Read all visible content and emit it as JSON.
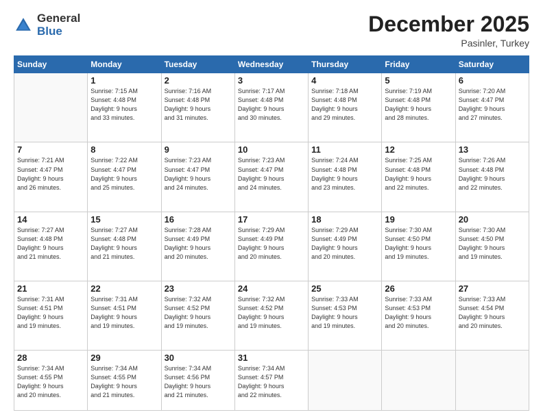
{
  "header": {
    "logo_general": "General",
    "logo_blue": "Blue",
    "month_title": "December 2025",
    "location": "Pasinler, Turkey"
  },
  "weekdays": [
    "Sunday",
    "Monday",
    "Tuesday",
    "Wednesday",
    "Thursday",
    "Friday",
    "Saturday"
  ],
  "weeks": [
    [
      {
        "day": "",
        "info": ""
      },
      {
        "day": "1",
        "info": "Sunrise: 7:15 AM\nSunset: 4:48 PM\nDaylight: 9 hours\nand 33 minutes."
      },
      {
        "day": "2",
        "info": "Sunrise: 7:16 AM\nSunset: 4:48 PM\nDaylight: 9 hours\nand 31 minutes."
      },
      {
        "day": "3",
        "info": "Sunrise: 7:17 AM\nSunset: 4:48 PM\nDaylight: 9 hours\nand 30 minutes."
      },
      {
        "day": "4",
        "info": "Sunrise: 7:18 AM\nSunset: 4:48 PM\nDaylight: 9 hours\nand 29 minutes."
      },
      {
        "day": "5",
        "info": "Sunrise: 7:19 AM\nSunset: 4:48 PM\nDaylight: 9 hours\nand 28 minutes."
      },
      {
        "day": "6",
        "info": "Sunrise: 7:20 AM\nSunset: 4:47 PM\nDaylight: 9 hours\nand 27 minutes."
      }
    ],
    [
      {
        "day": "7",
        "info": "Sunrise: 7:21 AM\nSunset: 4:47 PM\nDaylight: 9 hours\nand 26 minutes."
      },
      {
        "day": "8",
        "info": "Sunrise: 7:22 AM\nSunset: 4:47 PM\nDaylight: 9 hours\nand 25 minutes."
      },
      {
        "day": "9",
        "info": "Sunrise: 7:23 AM\nSunset: 4:47 PM\nDaylight: 9 hours\nand 24 minutes."
      },
      {
        "day": "10",
        "info": "Sunrise: 7:23 AM\nSunset: 4:47 PM\nDaylight: 9 hours\nand 24 minutes."
      },
      {
        "day": "11",
        "info": "Sunrise: 7:24 AM\nSunset: 4:48 PM\nDaylight: 9 hours\nand 23 minutes."
      },
      {
        "day": "12",
        "info": "Sunrise: 7:25 AM\nSunset: 4:48 PM\nDaylight: 9 hours\nand 22 minutes."
      },
      {
        "day": "13",
        "info": "Sunrise: 7:26 AM\nSunset: 4:48 PM\nDaylight: 9 hours\nand 22 minutes."
      }
    ],
    [
      {
        "day": "14",
        "info": "Sunrise: 7:27 AM\nSunset: 4:48 PM\nDaylight: 9 hours\nand 21 minutes."
      },
      {
        "day": "15",
        "info": "Sunrise: 7:27 AM\nSunset: 4:48 PM\nDaylight: 9 hours\nand 21 minutes."
      },
      {
        "day": "16",
        "info": "Sunrise: 7:28 AM\nSunset: 4:49 PM\nDaylight: 9 hours\nand 20 minutes."
      },
      {
        "day": "17",
        "info": "Sunrise: 7:29 AM\nSunset: 4:49 PM\nDaylight: 9 hours\nand 20 minutes."
      },
      {
        "day": "18",
        "info": "Sunrise: 7:29 AM\nSunset: 4:49 PM\nDaylight: 9 hours\nand 20 minutes."
      },
      {
        "day": "19",
        "info": "Sunrise: 7:30 AM\nSunset: 4:50 PM\nDaylight: 9 hours\nand 19 minutes."
      },
      {
        "day": "20",
        "info": "Sunrise: 7:30 AM\nSunset: 4:50 PM\nDaylight: 9 hours\nand 19 minutes."
      }
    ],
    [
      {
        "day": "21",
        "info": "Sunrise: 7:31 AM\nSunset: 4:51 PM\nDaylight: 9 hours\nand 19 minutes."
      },
      {
        "day": "22",
        "info": "Sunrise: 7:31 AM\nSunset: 4:51 PM\nDaylight: 9 hours\nand 19 minutes."
      },
      {
        "day": "23",
        "info": "Sunrise: 7:32 AM\nSunset: 4:52 PM\nDaylight: 9 hours\nand 19 minutes."
      },
      {
        "day": "24",
        "info": "Sunrise: 7:32 AM\nSunset: 4:52 PM\nDaylight: 9 hours\nand 19 minutes."
      },
      {
        "day": "25",
        "info": "Sunrise: 7:33 AM\nSunset: 4:53 PM\nDaylight: 9 hours\nand 19 minutes."
      },
      {
        "day": "26",
        "info": "Sunrise: 7:33 AM\nSunset: 4:53 PM\nDaylight: 9 hours\nand 20 minutes."
      },
      {
        "day": "27",
        "info": "Sunrise: 7:33 AM\nSunset: 4:54 PM\nDaylight: 9 hours\nand 20 minutes."
      }
    ],
    [
      {
        "day": "28",
        "info": "Sunrise: 7:34 AM\nSunset: 4:55 PM\nDaylight: 9 hours\nand 20 minutes."
      },
      {
        "day": "29",
        "info": "Sunrise: 7:34 AM\nSunset: 4:55 PM\nDaylight: 9 hours\nand 21 minutes."
      },
      {
        "day": "30",
        "info": "Sunrise: 7:34 AM\nSunset: 4:56 PM\nDaylight: 9 hours\nand 21 minutes."
      },
      {
        "day": "31",
        "info": "Sunrise: 7:34 AM\nSunset: 4:57 PM\nDaylight: 9 hours\nand 22 minutes."
      },
      {
        "day": "",
        "info": ""
      },
      {
        "day": "",
        "info": ""
      },
      {
        "day": "",
        "info": ""
      }
    ]
  ]
}
